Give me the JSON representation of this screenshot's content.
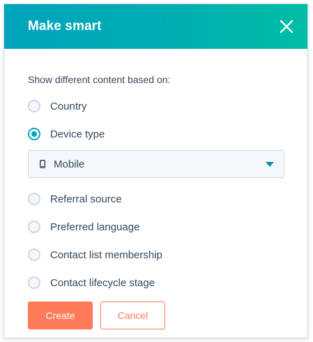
{
  "modal": {
    "title": "Make smart",
    "close_icon": "close-icon"
  },
  "form": {
    "prompt": "Show different content based on:",
    "options": [
      {
        "label": "Country",
        "checked": false
      },
      {
        "label": "Device type",
        "checked": true
      },
      {
        "label": "Referral source",
        "checked": false
      },
      {
        "label": "Preferred language",
        "checked": false
      },
      {
        "label": "Contact list membership",
        "checked": false
      },
      {
        "label": "Contact lifecycle stage",
        "checked": false
      }
    ],
    "device_select": {
      "icon": "mobile-phone-icon",
      "value": "Mobile"
    }
  },
  "buttons": {
    "create": "Create",
    "cancel": "Cancel"
  },
  "colors": {
    "header_start": "#00a4bd",
    "header_end": "#00bda5",
    "accent": "#00a4bd",
    "primary_button": "#ff7a59",
    "text": "#33475b"
  }
}
